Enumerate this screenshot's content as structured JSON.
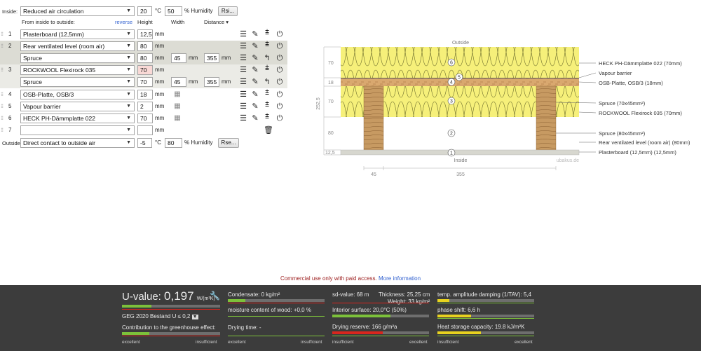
{
  "inside": {
    "label": "Inside:",
    "condition": "Reduced air circulation",
    "temperature": "20",
    "temp_unit": "°C",
    "humidity": "50",
    "humidity_unit": "% Humidity",
    "button": "Rsi..."
  },
  "header": {
    "from_label": "From inside to outside:",
    "reverse": "reverse",
    "col_height": "Height",
    "col_width": "Width",
    "col_distance": "Distance",
    "distance_marker": "▾"
  },
  "layers": [
    {
      "num": "1",
      "name": "Plasterboard (12,5mm)",
      "height": "12,5",
      "unit": "mm"
    },
    {
      "num": "2",
      "name": "Rear ventilated level (room air)",
      "height": "80",
      "unit": "mm",
      "sub": {
        "name": "Spruce",
        "height": "80",
        "width": "45",
        "distance": "355",
        "unit": "mm"
      }
    },
    {
      "num": "3",
      "name": "ROCKWOOL Flexirock 035",
      "height": "70",
      "unit": "mm",
      "sub": {
        "name": "Spruce",
        "height": "70",
        "width": "45",
        "distance": "355",
        "unit": "mm"
      }
    },
    {
      "num": "4",
      "name": "OSB-Platte, OSB/3",
      "height": "18",
      "unit": "mm"
    },
    {
      "num": "5",
      "name": "Vapour barrier",
      "height": "2",
      "unit": "mm"
    },
    {
      "num": "6",
      "name": "HECK PH-Dämmplatte 022",
      "height": "70",
      "unit": "mm"
    },
    {
      "num": "7",
      "name": "",
      "height": "",
      "unit": "mm"
    }
  ],
  "outside": {
    "label": "Outside",
    "condition": "Direct contact to outside air",
    "temperature": "-5",
    "temp_unit": "°C",
    "humidity": "80",
    "humidity_unit": "% Humidity",
    "button": "Rse..."
  },
  "diagram": {
    "top_label": "Outside",
    "bottom_label": "Inside",
    "watermark": "ubakus.de",
    "total": "252,5",
    "dims": [
      "70",
      "18",
      "70",
      "80",
      "12,5"
    ],
    "bottom_dims": [
      "45",
      "355"
    ],
    "legend": [
      "HECK PH-Dämmplatte 022 (70mm)",
      "Vapour barrier",
      "OSB-Platte, OSB/3 (18mm)",
      "Spruce (70x45mm²)",
      "ROCKWOOL Flexirock 035 (70mm)",
      "Spruce (80x45mm²)",
      "Rear ventilated level (room air) (80mm)",
      "Plasterboard (12,5mm) (12,5mm)"
    ],
    "circles": [
      "6",
      "5",
      "4",
      "3",
      "2",
      "1"
    ]
  },
  "notice": {
    "text": "Commercial use only with paid access.",
    "more": "More information"
  },
  "results": {
    "uvalue_label": "U-value:",
    "uvalue": "0,197",
    "uvalue_unit": "W/(m²K)",
    "standard": "GEG 2020 Bestand U ≤ 0,2",
    "greenhouse": "Contribution to the greenhouse effect:",
    "condensate": "Condensate: 0 kg/m²",
    "moisture": "moisture content of wood: +0,0 %",
    "drying_time": "Drying time: -",
    "sd_value": "sd-value: 68 m",
    "thickness": "Thickness: 25,25 cm",
    "weight": "Weight: 33 kg/m²",
    "interior_surface": "Interior surface: 20,0°C (50%)",
    "drying_reserve": "Drying reserve: 166 g/m²a",
    "temp_damping": "temp. amplitude damping (1/TAV): 5,4",
    "phase_shift": "phase shift: 6,6 h",
    "heat_storage": "Heat storage capacity: 19.8 kJ/m²K",
    "excellent": "excellent",
    "insufficient": "insufficient"
  },
  "colors": {
    "panel_bg": "#3c3c3c",
    "bar_green": "#7cc13a",
    "bar_yellow": "#e8d21f",
    "bar_red": "#d8261e",
    "insulation": "#f6f07a",
    "wood": "#c79a62",
    "link": "#2f5fcf"
  },
  "bars": {
    "uvalue": 0.3,
    "greenhouse": 0.28,
    "condensate": 0.18,
    "sd_value": 0.5,
    "interior_surface": 0.6,
    "drying_reserve": 0.52,
    "temp_damping": 0.12,
    "phase_shift": 0.35,
    "heat_storage": 0.45
  }
}
